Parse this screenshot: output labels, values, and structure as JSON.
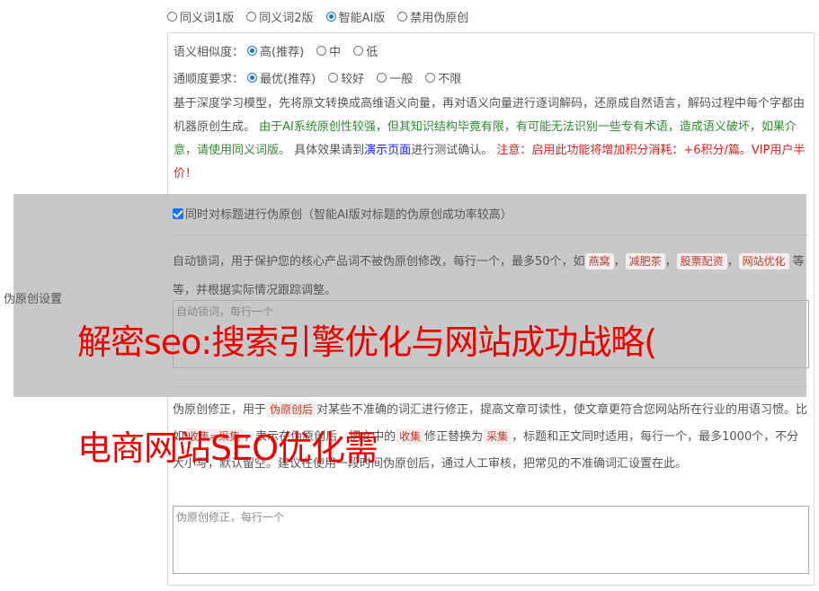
{
  "mode": {
    "options": [
      "同义词1版",
      "同义词2版",
      "智能AI版",
      "禁用伪原创"
    ],
    "selected_index": 2
  },
  "similarity": {
    "label": "语义相似度：",
    "options": [
      "高(推荐)",
      "中",
      "低"
    ],
    "selected_index": 0
  },
  "fluency": {
    "label": "通顺度要求：",
    "options": [
      "最优(推荐)",
      "较好",
      "一般",
      "不限"
    ],
    "selected_index": 0
  },
  "description": {
    "part1": "基于深度学习模型，先将原文转换成高维语义向量，再对语义向量进行逐词解码，还原成自然语言，解码过程中每个字都由机器原创生成。",
    "part2_green": "由于AI系统原创性较强，但其知识结构毕竟有限，有可能无法识别一些专有术语，造成语义破坏，如果介意，请使用同义词版。",
    "part3": "具体效果请到",
    "part4_link": "演示页面",
    "part5": "进行测试确认。",
    "part6_red": "注意：启用此功能将增加积分消耗：+6积分/篇。VIP用户半价！"
  },
  "side_label": "伪原创设置",
  "title_check": {
    "label": "同时对标题进行伪原创（智能AI版对标题的伪原创成功率较高）",
    "checked": true
  },
  "lock": {
    "desc_pre": "自动锁词，用于保护您的核心产品词不被伪原创修改，每行一个，最多50个，如",
    "examples": [
      "燕窝",
      "减肥茶",
      "股票配资",
      "网站优化"
    ],
    "separator": "，",
    "desc_post": "等等，并根据实际情况跟踪调整。",
    "placeholder": "自动锁词，每行一个"
  },
  "fix": {
    "t1": "伪原创修正，用于",
    "tag1": "伪原创后",
    "t2": "对某些不准确的词汇进行修正，提高文章可读性，使文章更符合您网站所在行业的用语习惯。比如",
    "tag2": "收集=采集",
    "t3": "，表示在伪原创后，把文中的",
    "tag3": "收集",
    "t4": "修正替换为",
    "tag4": "采集",
    "t5": "，标题和正文同时适用，每行一个，最多1000个，不分大小写，默认留空。建议在使用一段时间伪原创后，通过人工审核，把常见的不准确词汇设置在此。",
    "placeholder": "伪原创修正，每行一个"
  },
  "watermark": {
    "line1": "解密seo:搜索引擎优化与网站成功战略(",
    "line2": "电商网站SEO优化需"
  }
}
